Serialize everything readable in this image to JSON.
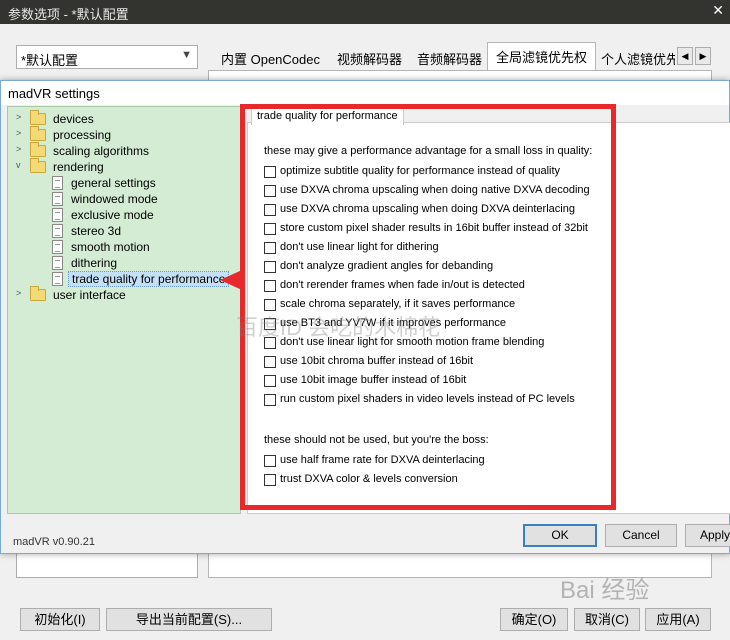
{
  "outer": {
    "title": "参数选项 - *默认配置",
    "close_glyph": "✕",
    "profile_select": "*默认配置",
    "tabs": [
      "内置 OpenCodec",
      "视频解码器",
      "音频解码器",
      "全局滤镜优先权",
      "个人滤镜优先"
    ],
    "buttons": {
      "reset": "初始化(I)",
      "export": "导出当前配置(S)...",
      "ok": "确定(O)",
      "cancel": "取消(C)",
      "apply": "应用(A)"
    }
  },
  "madvr": {
    "title": "madVR settings",
    "version": "madVR v0.90.21",
    "tree": [
      {
        "label": "devices",
        "type": "folder"
      },
      {
        "label": "processing",
        "type": "folder"
      },
      {
        "label": "scaling algorithms",
        "type": "folder"
      },
      {
        "label": "rendering",
        "type": "folder"
      },
      {
        "label": "general settings",
        "type": "page"
      },
      {
        "label": "windowed mode",
        "type": "page"
      },
      {
        "label": "exclusive mode",
        "type": "page"
      },
      {
        "label": "stereo 3d",
        "type": "page"
      },
      {
        "label": "smooth motion",
        "type": "page"
      },
      {
        "label": "dithering",
        "type": "page"
      },
      {
        "label": "trade quality for performance",
        "type": "page"
      },
      {
        "label": "user interface",
        "type": "folder"
      }
    ],
    "content_tab": "trade quality for performance",
    "group1_title": "these may give a performance advantage for a small loss in quality:",
    "options1": [
      "optimize subtitle quality for performance instead of quality",
      "use DXVA chroma upscaling when doing native DXVA decoding",
      "use DXVA chroma upscaling when doing DXVA deinterlacing",
      "store custom pixel shader results in 16bit buffer instead of 32bit",
      "don't use linear light for dithering",
      "don't analyze gradient angles for debanding",
      "don't rerender frames when fade in/out is detected",
      "scale chroma separately, if it saves performance",
      "use BT3 and YV7W if it improves performance",
      "don't use linear light for smooth motion frame blending",
      "use 10bit chroma buffer instead of 16bit",
      "use 10bit image buffer instead of 16bit",
      "run custom pixel shaders in video levels instead of PC levels"
    ],
    "group2_title": "these should not be used, but you're the boss:",
    "options2": [
      "use half frame rate for DXVA deinterlacing",
      "trust DXVA color & levels conversion"
    ],
    "buttons": {
      "ok": "OK",
      "cancel": "Cancel",
      "apply": "Apply"
    }
  },
  "watermarks": {
    "center": "百度ID 会吃的木棉花",
    "corner": "Bai 经验"
  },
  "colors": {
    "annotation_red": "#e8292b",
    "tree_bg": "#d4ecd4",
    "titlebar_dark": "#33332f"
  }
}
